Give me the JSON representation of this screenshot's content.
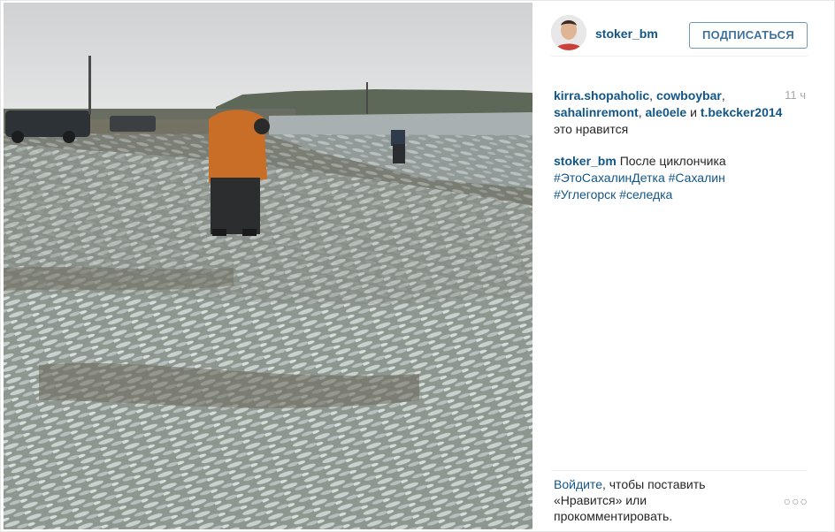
{
  "post": {
    "username": "stoker_bm",
    "follow_label": "ПОДПИСАТЬСЯ",
    "time_ago": "11 ч",
    "likers": [
      "kirra.shopaholic",
      "cowboybar",
      "sahalinremont",
      "ale0ele",
      "t.bekcker2014"
    ],
    "likes_connector": "и",
    "likes_suffix": "это нравится",
    "caption_user": "stoker_bm",
    "caption_text": "После циклончика",
    "hashtags": [
      "#ЭтоСахалинДетка",
      "#Сахалин",
      "#Углегорск",
      "#селедка"
    ],
    "login_link": "Войдите",
    "login_text": ", чтобы поставить «Нравится» или прокомментировать.",
    "more_icon": "ellipsis-icon"
  },
  "colors": {
    "link": "#125688",
    "follow": "#3f729b",
    "muted": "#a5a7aa"
  }
}
